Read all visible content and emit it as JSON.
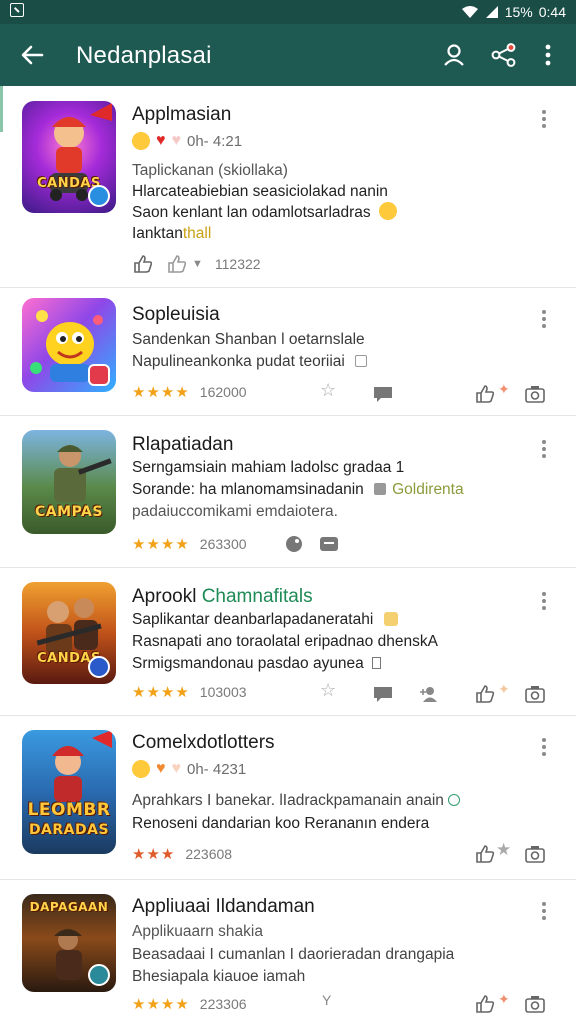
{
  "status_bar": {
    "battery": "15%",
    "time": "0:44"
  },
  "app_bar": {
    "title": "Nedanplasai"
  },
  "colors": {
    "app_bar": "#1f5a52",
    "status_bar": "#1a4d46",
    "star": "#f2a218",
    "accent": "#8bc5a9"
  },
  "apps": [
    {
      "title": "Applmasian",
      "meta": "0h- 4:21",
      "lines": [
        "Taplickanan (skiollaka)",
        "Hlarcateabiebian seasiciolakad nanin",
        "Saon kenlant lan odamlotsarladras"
      ],
      "line4_a": "Ianktan",
      "line4_b": "thall",
      "count": "112322",
      "icons": [
        "thumb-up-icon",
        "thumb-up-outline-icon",
        "dropdown-icon"
      ]
    },
    {
      "title": "Sopleuisia",
      "lines": [
        "Sandenkan Shanban l oetarnslale",
        "Napulineankonka pudat teoriiai"
      ],
      "stars": "★★★★",
      "count": "162000"
    },
    {
      "title": "Rlapatiadan",
      "lines": [
        "Serngamsiain mahiam ladolsc gradaa  1",
        "Sorande: ha mlanomamsinadanin",
        "padaiuccomikami emdaiotera."
      ],
      "line2_extra": "Goldirenta",
      "stars": "★★★★",
      "count": "263300"
    },
    {
      "title_a": "Aprookl",
      "title_b": "Chamnafitals",
      "lines": [
        "Saplikantar deanbarlapadaneratahi",
        "Rasnapati ano toraolatal eripadnao dhenskA",
        "Srmigsmandonau pasdao ayunea"
      ],
      "stars": "★★★★",
      "count": "103003"
    },
    {
      "title": "Comelxdotlotters",
      "meta": "0h- 4231",
      "lines": [
        "Aprahkars I banekar. lIadrackpamanain anain",
        "Renoseni dandarian koo Rerananın endera"
      ],
      "stars": "★★★",
      "count": "223608"
    },
    {
      "title": "Appliuaai Ildandaman",
      "lines": [
        "Applikuaarn shakia",
        "Beasadaai I cumanlan I daorieradan drangapia",
        "Bhesiapala kiauoe iamah"
      ],
      "stars": "★★★★",
      "count": "223306"
    }
  ]
}
